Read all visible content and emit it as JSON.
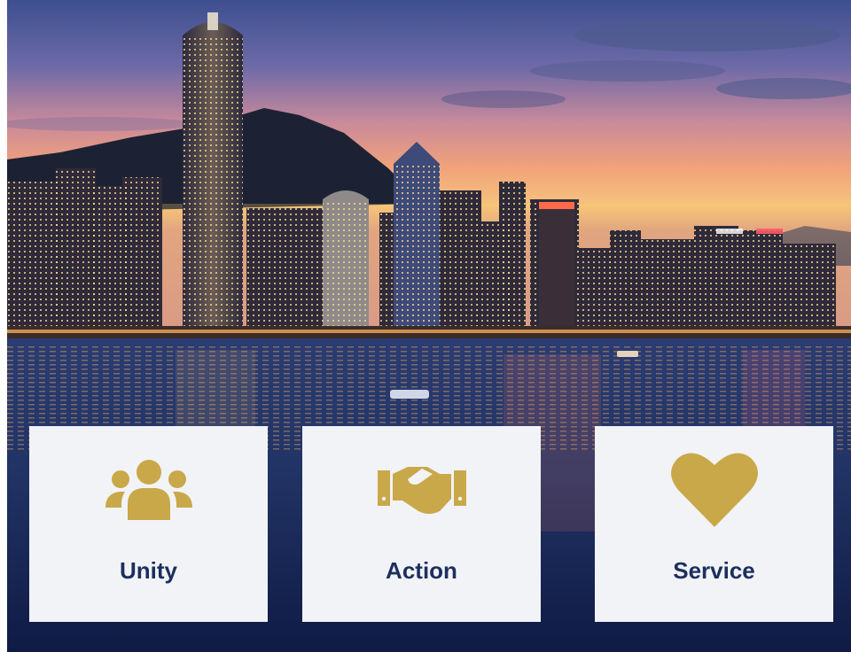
{
  "hero": {
    "image": "hong-kong-skyline-at-dusk"
  },
  "cards": [
    {
      "label": "Unity",
      "icon": "people-group-icon"
    },
    {
      "label": "Action",
      "icon": "handshake-icon"
    },
    {
      "label": "Service",
      "icon": "heart-icon"
    }
  ],
  "colors": {
    "accent_gold": "#c9a84a",
    "card_background": "#f2f3f6",
    "label_navy": "#1c2f5e"
  }
}
